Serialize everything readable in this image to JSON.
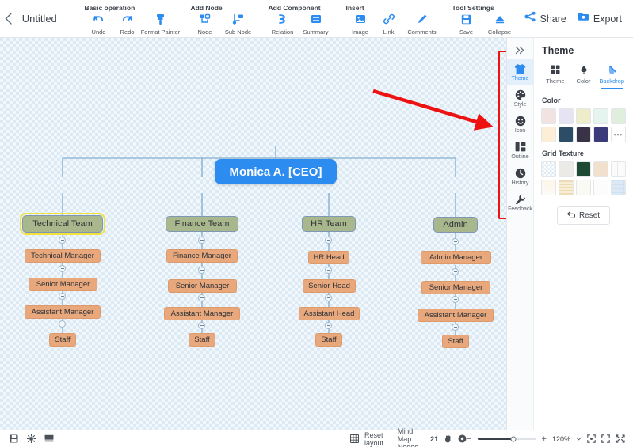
{
  "header": {
    "back_icon": "chevron-left-icon",
    "doc_title": "Untitled",
    "groups": [
      {
        "label": "Basic operation",
        "items": [
          {
            "label": "Undo",
            "icon": "undo-icon"
          },
          {
            "label": "Redo",
            "icon": "redo-icon"
          },
          {
            "label": "Format Painter",
            "icon": "format-painter-icon"
          }
        ]
      },
      {
        "label": "Add Node",
        "items": [
          {
            "label": "Node",
            "icon": "add-node-icon"
          },
          {
            "label": "Sub Node",
            "icon": "add-sub-node-icon"
          }
        ]
      },
      {
        "label": "Add Component",
        "items": [
          {
            "label": "Relation",
            "icon": "relation-icon"
          },
          {
            "label": "Summary",
            "icon": "summary-icon"
          }
        ]
      },
      {
        "label": "Insert",
        "items": [
          {
            "label": "Image",
            "icon": "image-icon"
          },
          {
            "label": "Link",
            "icon": "link-icon"
          },
          {
            "label": "Comments",
            "icon": "comments-icon"
          }
        ]
      },
      {
        "label": "Tool Settings",
        "items": [
          {
            "label": "Save",
            "icon": "save-icon"
          },
          {
            "label": "Collapse",
            "icon": "collapse-icon"
          }
        ]
      }
    ],
    "share_label": "Share",
    "share_icon": "share-icon",
    "export_label": "Export",
    "export_icon": "export-icon"
  },
  "mindmap": {
    "root": {
      "label": "Monica A. [CEO]"
    },
    "branches": [
      {
        "team": "Technical Team",
        "selected": true,
        "children": [
          "Technical Manager",
          "Senior Manager",
          "Assistant Manager",
          "Staff"
        ]
      },
      {
        "team": "Finance Team",
        "selected": false,
        "children": [
          "Finance Manager",
          "Senior Manager",
          "Assistant Manager",
          "Staff"
        ]
      },
      {
        "team": "HR Team",
        "selected": false,
        "children": [
          "HR Head",
          "Senior Head",
          "Assistant Head",
          "Staff"
        ]
      },
      {
        "team": "Admin",
        "selected": false,
        "children": [
          "Admin Manager",
          "Senior Manager",
          "Assistant Manager",
          "Staff"
        ]
      }
    ]
  },
  "annotation": {
    "arrow_color": "#ee1111",
    "highlight_color": "#ee1111"
  },
  "right_panel": {
    "collapse_icon": "chevrons-right-icon",
    "title": "Theme",
    "rail": [
      {
        "label": "Theme",
        "icon": "tshirt-icon",
        "active": true
      },
      {
        "label": "Style",
        "icon": "palette-icon",
        "active": false
      },
      {
        "label": "Icon",
        "icon": "smiley-icon",
        "active": false
      },
      {
        "label": "Outline",
        "icon": "outline-icon",
        "active": false
      },
      {
        "label": "History",
        "icon": "clock-icon",
        "active": false
      },
      {
        "label": "Feedback",
        "icon": "wrench-icon",
        "active": false
      }
    ],
    "tabs": [
      {
        "label": "Theme",
        "icon": "grid-icon",
        "active": false
      },
      {
        "label": "Color",
        "icon": "paint-bucket-icon",
        "active": false
      },
      {
        "label": "Backdrop",
        "icon": "backdrop-icon",
        "active": true
      }
    ],
    "color_section": {
      "label": "Color",
      "swatches": [
        "#f3e2e2",
        "#e6e3f3",
        "#efecc9",
        "#e6f4ef",
        "#dfeedd",
        "#fdeed7",
        "#2d4d66",
        "#3a3348",
        "#3b3a7a",
        "more"
      ],
      "more_glyph": "•••"
    },
    "grid_section": {
      "label": "Grid Texture",
      "swatches": [
        "checker-blue",
        "gray-plain",
        "green-solid",
        "beige-plain",
        "white-lines",
        "cream-gradient",
        "straw-lines",
        "ivory-plain",
        "white-fold",
        "lightblue-grid"
      ]
    },
    "reset_label": "Reset",
    "reset_icon": "undo-arrow-icon"
  },
  "statusbar": {
    "left_icons": [
      {
        "name": "save-status-icon"
      },
      {
        "name": "focus-icon"
      },
      {
        "name": "layers-icon"
      }
    ],
    "reset_layout_label": "Reset layout",
    "reset_layout_icon": "grid-layout-icon",
    "nodes_label": "Mind Map Nodes :",
    "nodes_count": "21",
    "hand_icon": "hand-tool-icon",
    "target_icon": "target-icon",
    "zoom_minus": "−",
    "zoom_plus": "+",
    "zoom_value": "120%",
    "zoom_caret": "chevron-down-icon",
    "fit_icon": "fit-screen-icon",
    "expand_icon": "expand-icon",
    "fullscreen_icon": "fullscreen-icon"
  }
}
